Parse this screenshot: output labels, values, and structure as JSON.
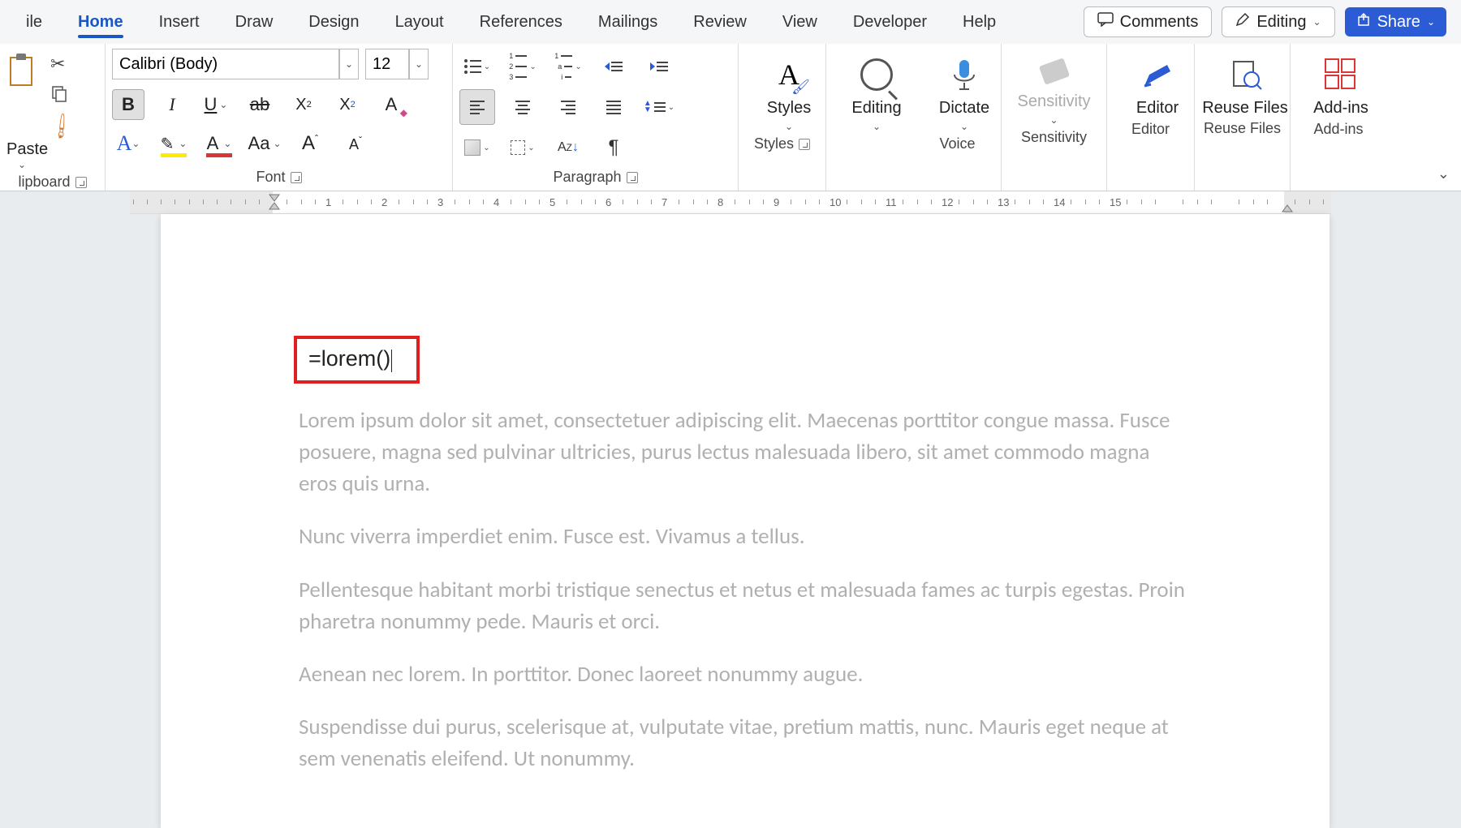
{
  "tabs": {
    "file": "ile",
    "home": "Home",
    "insert": "Insert",
    "draw": "Draw",
    "design": "Design",
    "layout": "Layout",
    "references": "References",
    "mailings": "Mailings",
    "review": "Review",
    "view": "View",
    "developer": "Developer",
    "help": "Help"
  },
  "topright": {
    "comments": "Comments",
    "editing": "Editing",
    "share": "Share"
  },
  "clipboard": {
    "paste": "Paste",
    "group_label": "lipboard"
  },
  "font": {
    "name": "Calibri (Body)",
    "size": "12",
    "group_label": "Font"
  },
  "paragraph": {
    "group_label": "Paragraph"
  },
  "styles": {
    "label": "Styles",
    "group_label": "Styles"
  },
  "editing": {
    "label": "Editing"
  },
  "voice": {
    "dictate": "Dictate",
    "group_label": "Voice"
  },
  "sensitivity": {
    "label": "Sensitivity",
    "group_label": "Sensitivity"
  },
  "editor": {
    "label": "Editor",
    "group_label": "Editor"
  },
  "reuse": {
    "label": "Reuse Files",
    "group_label": "Reuse Files"
  },
  "addins": {
    "label": "Add-ins",
    "group_label": "Add-ins"
  },
  "ruler": {
    "numbers": [
      "1",
      "2",
      "3",
      "4",
      "5",
      "6",
      "7",
      "8",
      "9",
      "10",
      "11",
      "12",
      "13",
      "14",
      "15"
    ]
  },
  "document": {
    "formula": "=lorem()",
    "p1": "Lorem ipsum dolor sit amet, consectetuer adipiscing elit. Maecenas porttitor congue massa. Fusce posuere, magna sed pulvinar ultricies, purus lectus malesuada libero, sit amet commodo magna eros quis urna.",
    "p2": "Nunc viverra imperdiet enim. Fusce est. Vivamus a tellus.",
    "p3": "Pellentesque habitant morbi tristique senectus et netus et malesuada fames ac turpis egestas. Proin pharetra nonummy pede. Mauris et orci.",
    "p4": "Aenean nec lorem. In porttitor. Donec laoreet nonummy augue.",
    "p5": "Suspendisse dui purus, scelerisque at, vulputate vitae, pretium mattis, nunc. Mauris eget neque at sem venenatis eleifend. Ut nonummy."
  }
}
